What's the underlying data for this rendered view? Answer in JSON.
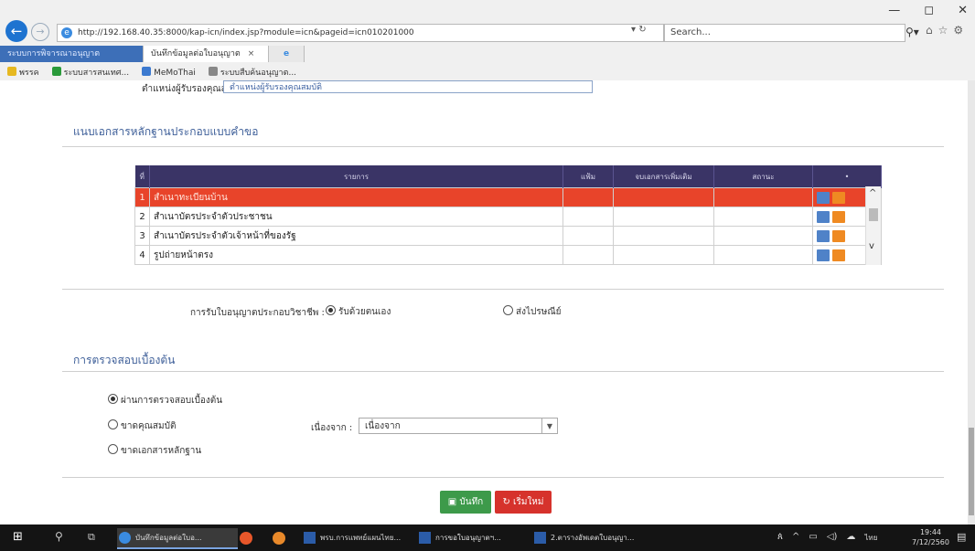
{
  "browser": {
    "url": "http://192.168.40.35:8000/kap-icn/index.jsp?module=icn&pageid=icn010201000",
    "search_placeholder": "Search...",
    "window_controls": [
      "—",
      "◻",
      "✕"
    ],
    "tabs": [
      {
        "label": "ระบบการพิจารณาอนุญาต",
        "active": false
      },
      {
        "label": "บันทึกข้อมูลต่อใบอนุญาต",
        "active": true
      }
    ],
    "favorites": [
      "พรรค",
      "ระบบสารสนเทศ...",
      "MeMoThai",
      "ระบบสืบค้นอนุญาต..."
    ]
  },
  "form": {
    "top_label": "ตำแหน่งผู้รับรองคุณสมบัติ :",
    "top_value": "ตำแหน่งผู้รับรองคุณสมบัติ"
  },
  "docs_section": {
    "title": "แนบเอกสารหลักฐานประกอบแบบคำขอ",
    "columns": [
      "ที่",
      "รายการ",
      "แฟ้ม",
      "จบเอกสารเพิ่มเติม",
      "สถานะ",
      "•"
    ],
    "rows": [
      {
        "no": "1",
        "item": "สำเนาทะเบียนบ้าน",
        "selected": true
      },
      {
        "no": "2",
        "item": "สำเนาบัตรประจำตัวประชาชน",
        "selected": false
      },
      {
        "no": "3",
        "item": "สำเนาบัตรประจำตัวเจ้าหน้าที่ของรัฐ",
        "selected": false
      },
      {
        "no": "4",
        "item": "รูปถ่ายหน้าตรง",
        "selected": false
      }
    ]
  },
  "delivery": {
    "label": "การรับใบอนุญาตประกอบวิชาชีพ :",
    "options": [
      {
        "label": "รับด้วยตนเอง",
        "checked": true
      },
      {
        "label": "ส่งไปรษณีย์",
        "checked": false
      }
    ]
  },
  "check_section": {
    "title": "การตรวจสอบเบื้องต้น",
    "options": [
      {
        "label": "ผ่านการตรวจสอบเบื้องต้น",
        "checked": true
      },
      {
        "label": "ขาดคุณสมบัติ",
        "checked": false
      },
      {
        "label": "ขาดเอกสารหลักฐาน",
        "checked": false
      }
    ],
    "reason_label": "เนื่องจาก :",
    "reason_value": "เนื่องจาก"
  },
  "buttons": {
    "save": "บันทึก",
    "reset": "เริ่มใหม่"
  },
  "taskbar": {
    "items": [
      "บันทึกข้อมูลต่อใบอ...",
      "พรบ.การแพทย์แผนไทย...",
      "การขอใบอนุญาตฯ...",
      "2.ตารางอัพเดตใบอนุญา..."
    ],
    "time": "19:44",
    "date": "7/12/2560",
    "lang": "ไทย"
  }
}
